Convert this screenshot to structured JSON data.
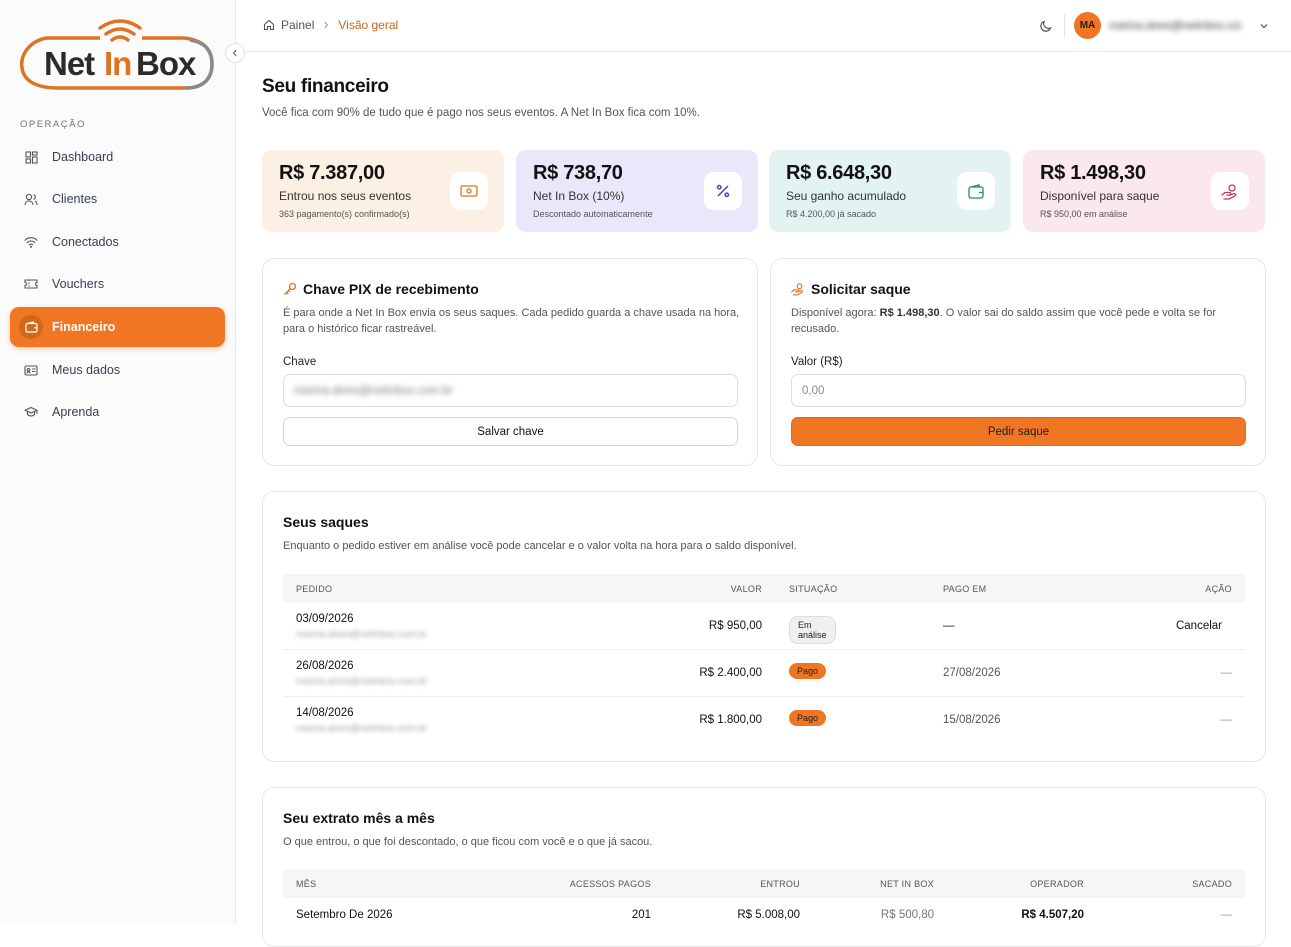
{
  "brand": {
    "logo_text_a": "Net",
    "logo_text_b": "In",
    "logo_text_c": "Box"
  },
  "sidebar": {
    "section": "OPERAÇÃO",
    "items": [
      {
        "label": "Dashboard",
        "icon": "dashboard-icon"
      },
      {
        "label": "Clientes",
        "icon": "users-icon"
      },
      {
        "label": "Conectados",
        "icon": "wifi-icon"
      },
      {
        "label": "Vouchers",
        "icon": "ticket-icon"
      },
      {
        "label": "Financeiro",
        "icon": "wallet-icon",
        "active": true
      },
      {
        "label": "Meus dados",
        "icon": "id-card-icon"
      },
      {
        "label": "Aprenda",
        "icon": "graduation-cap-icon"
      }
    ]
  },
  "header": {
    "breadcrumb": {
      "root": "Painel",
      "current": "Visão geral"
    },
    "user": {
      "initials": "MA",
      "email": "marina.alves@netinbox.com"
    }
  },
  "page": {
    "title": "Seu financeiro",
    "subtitle": "Você fica com 90% de tudo que é pago nos seus eventos. A Net In Box fica com 10%."
  },
  "stats": [
    {
      "value": "R$ 7.387,00",
      "label": "Entrou nos seus eventos",
      "sub": "363 pagamento(s) confirmado(s)",
      "bg": "#fcefe3",
      "icon": "cash-icon",
      "color": "#e07222"
    },
    {
      "value": "R$ 738,70",
      "label": "Net In Box (10%)",
      "sub": "Descontado automaticamente",
      "bg": "#e9e8fb",
      "icon": "percent-icon",
      "color": "#4a46b8"
    },
    {
      "value": "R$ 6.648,30",
      "label": "Seu ganho acumulado",
      "sub": "R$ 4.200,00 já sacado",
      "bg": "#e3f3f1",
      "icon": "wallet-icon",
      "color": "#1f8a80"
    },
    {
      "value": "R$ 1.498,30",
      "label": "Disponível para saque",
      "sub": "R$ 950,00 em análise",
      "bg": "#fbe8ee",
      "icon": "hand-coins-icon",
      "color": "#b83a66"
    }
  ],
  "pix": {
    "title": "Chave PIX de recebimento",
    "desc": "É para onde a Net In Box envia os seus saques. Cada pedido guarda a chave usada na hora, para o histórico ficar rastreável.",
    "field_label": "Chave",
    "field_value": "marina.alves@netinbox.com.br",
    "button": "Salvar chave"
  },
  "withdraw": {
    "title": "Solicitar saque",
    "desc_prefix": "Disponível agora: ",
    "desc_amount": "R$ 1.498,30",
    "desc_suffix": ". O valor sai do saldo assim que você pede e volta se for recusado.",
    "field_label": "Valor (R$)",
    "placeholder": "0,00",
    "button": "Pedir saque"
  },
  "saques": {
    "title": "Seus saques",
    "desc": "Enquanto o pedido estiver em análise você pode cancelar e o valor volta na hora para o saldo disponível.",
    "headers": {
      "pedido": "PEDIDO",
      "valor": "VALOR",
      "situacao": "SITUAÇÃO",
      "pago_em": "PAGO EM",
      "acao": "AÇÃO"
    },
    "rows": [
      {
        "date": "03/09/2026",
        "key": "marina.alves@netinbox.com.br",
        "value": "R$ 950,00",
        "status": "Em análise",
        "paid": "—",
        "action": "Cancelar"
      },
      {
        "date": "26/08/2026",
        "key": "marina.alves@netinbox.com.br",
        "value": "R$ 2.400,00",
        "status": "Pago",
        "paid": "27/08/2026",
        "action": "—"
      },
      {
        "date": "14/08/2026",
        "key": "marina.alves@netinbox.com.br",
        "value": "R$ 1.800,00",
        "status": "Pago",
        "paid": "15/08/2026",
        "action": "—"
      }
    ]
  },
  "extrato": {
    "title": "Seu extrato mês a mês",
    "desc": "O que entrou, o que foi descontado, o que ficou com você e o que já sacou.",
    "headers": {
      "mes": "MÊS",
      "acessos": "ACESSOS PAGOS",
      "entrou": "ENTROU",
      "netinbox": "NET IN BOX",
      "operador": "OPERADOR",
      "sacado": "SACADO"
    },
    "rows": [
      {
        "mes": "Setembro De 2026",
        "acessos": "201",
        "entrou": "R$ 5.008,00",
        "netinbox": "R$ 500,80",
        "operador": "R$ 4.507,20",
        "sacado": "—"
      }
    ]
  }
}
